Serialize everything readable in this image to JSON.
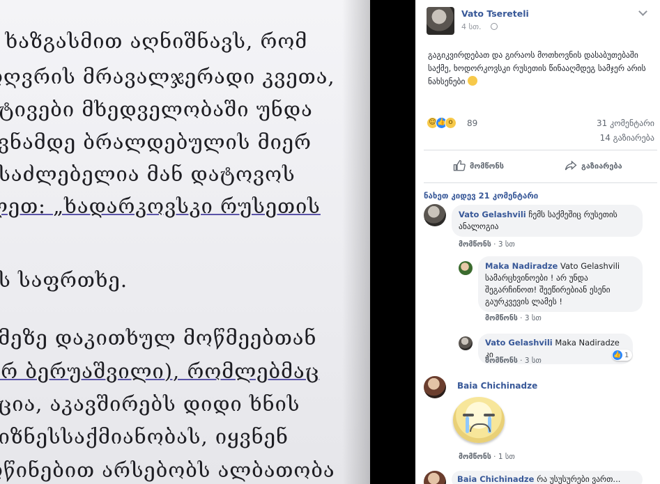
{
  "photo": {
    "lines": [
      "ე ხაზგასმით აღნიშნავს, რომ",
      "ოღვრის მრავალჯერადი კვეთა,",
      "ქტივები მხედველობაში უნდა",
      "კვნამდე ბრალდებულის მიერ",
      "ესაძლებელია მან დატოვოს",
      "ლეთ: „ხადარკოვსკი რუსეთის",
      "ის საფრთხე.",
      "ემეზე დაკითხულ მოწმეებთან",
      "ურ ბერუაშვილი), რომლებმაც",
      "აცია, აკავშირებს დიდი ხნის",
      "ბიზნესსაქმიანობას, იყვნენ",
      "ოწინებით არსებობს ალბათობა"
    ]
  },
  "post": {
    "author": "Vato Tsereteli",
    "time": "4 სთ.",
    "text": "გაგიკვირდებათ და გირაოს მოთხოვნის დასაბუთებაში საქმე, ხოდორკოვსკი რუსეთის წინააღმდეგ სამჯერ არის ნახსენები",
    "reaction_count": "89",
    "comments_count": "31 კომენტარი",
    "shares_count": "14 გაზიარება",
    "like_action": "მომწონს",
    "share_action": "გაზიარება"
  },
  "comments_section": {
    "view_more": "ნახეთ კიდევ 21 კომენტარი",
    "comments": [
      {
        "author": "Vato Gelashvili",
        "text": "ჩემს საქმეშიც რუსეთის ანალოგია",
        "like_label": "მომწონს",
        "time": "3 სთ"
      },
      {
        "author": "Maka Nadiradze",
        "text": "Vato Gelashvili სამარცხვინოები ! არ უნდა შეგარჩინოთ! შეეწირებიან ესენი გაურკვევის ლამეს !",
        "like_label": "მომწონს",
        "time": "3 სთ"
      },
      {
        "author": "Vato Gelashvili",
        "text": "Maka Nadiradze კი",
        "like_label": "მომწონს",
        "time": "3 სთ",
        "likes": "1"
      },
      {
        "author": "Baia Chichinadze",
        "text": "",
        "like_label": "მომწონს",
        "time": "1 სთ"
      },
      {
        "author": "Baia Chichinadze",
        "text": "რა უსუსურები ვართ..."
      }
    ]
  }
}
